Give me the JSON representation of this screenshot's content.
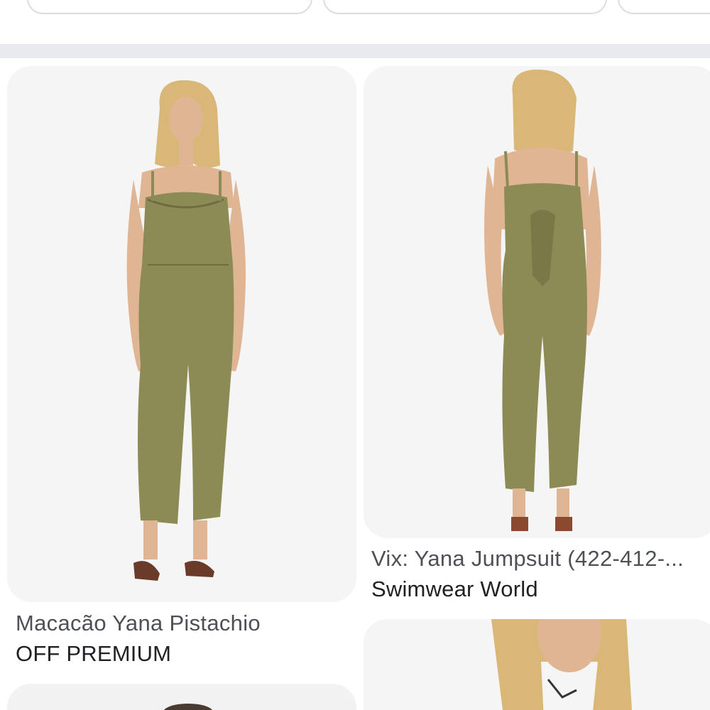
{
  "filter_chips": [
    "",
    "",
    ""
  ],
  "results": [
    {
      "image_name": "olive-jumpsuit-front-image",
      "title": "Macacão Yana Pistachio",
      "source": "OFF PREMIUM"
    },
    {
      "image_name": "olive-jumpsuit-back-image",
      "title": "Vix: Yana Jumpsuit (422-412-...",
      "source": "Swimwear World"
    },
    {
      "image_name": "model-closeup-image",
      "title": "",
      "source": ""
    },
    {
      "image_name": "model-partial-image",
      "title": "",
      "source": ""
    }
  ],
  "colors": {
    "card_bg": "#f5f5f5",
    "title_text": "#4d5156",
    "source_text": "#202124",
    "garment_olive": "#8c8a55",
    "hair_blonde": "#d9b777",
    "skin": "#e0b594"
  }
}
